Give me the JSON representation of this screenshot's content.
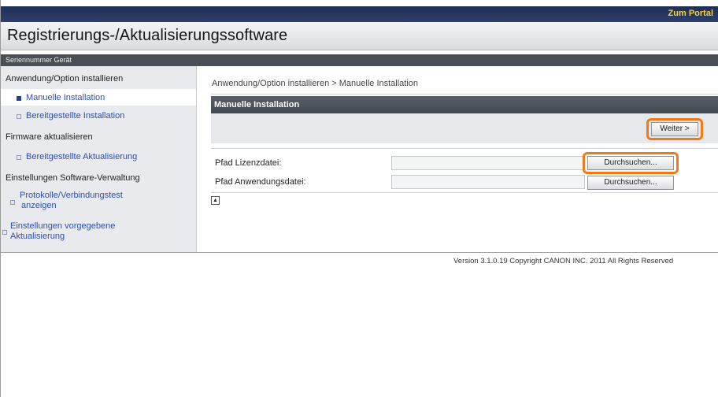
{
  "header": {
    "portal_link": "Zum Portal",
    "title": "Registrierungs-/Aktualisierungssoftware",
    "serial_label": "Seriennummer Gerät"
  },
  "sidebar": {
    "section1": "Anwendung/Option installieren",
    "item_manual": "Manuelle Installation",
    "item_provided": "Bereitgestellte Installation",
    "section2": "Firmware aktualisieren",
    "item_provided_update": "Bereitgestellte Aktualisierung",
    "section3": "Einstellungen Software-Verwaltung",
    "item_logs_line1": "Protokolle/Verbindungstest",
    "item_logs_line2": "anzeigen",
    "item_default_line1": "Einstellungen vorgegebene",
    "item_default_line2": "Aktualisierung"
  },
  "main": {
    "breadcrumb": "Anwendung/Option installieren > Manuelle Installation",
    "panel_title": "Manuelle Installation",
    "next_button": "Weiter >",
    "license_label": "Pfad Lizenzdatei:",
    "app_label": "Pfad Anwendungsdatei:",
    "browse_button": "Durchsuchen...",
    "license_value": "",
    "app_value": ""
  },
  "footer": {
    "version": "Version 3.1.0.19 Copyright CANON INC. 2011 All Rights Reserved"
  },
  "colors": {
    "topbar": "#2d3f6c",
    "portal_link": "#f0d24a",
    "highlight": "#f07a19",
    "panel_header": "#4c5259",
    "nav_link": "#2f4fa8"
  }
}
